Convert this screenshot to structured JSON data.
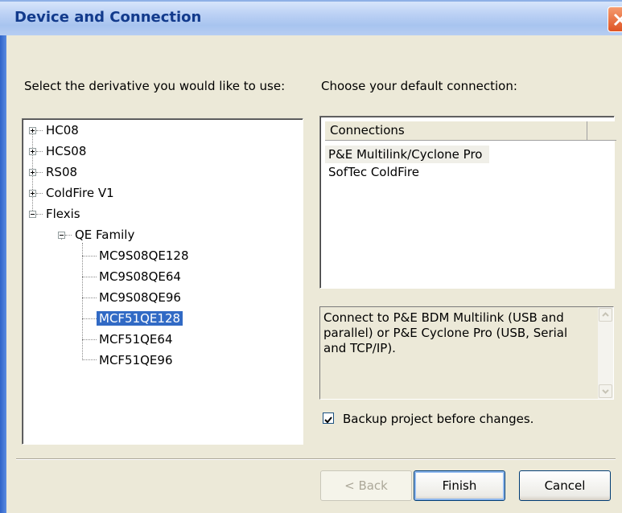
{
  "window": {
    "title": "Device and Connection"
  },
  "left": {
    "prompt": "Select the derivative you would like to use:",
    "tree": [
      {
        "label": "HC08",
        "expander": "+"
      },
      {
        "label": "HCS08",
        "expander": "+"
      },
      {
        "label": "RS08",
        "expander": "+"
      },
      {
        "label": "ColdFire V1",
        "expander": "+"
      },
      {
        "label": "Flexis",
        "expander": "−"
      },
      {
        "label": "QE Family",
        "expander": "−"
      },
      {
        "label": "MC9S08QE128"
      },
      {
        "label": "MC9S08QE64"
      },
      {
        "label": "MC9S08QE96"
      },
      {
        "label": "MCF51QE128",
        "selected": true
      },
      {
        "label": "MCF51QE64"
      },
      {
        "label": "MCF51QE96"
      }
    ]
  },
  "right": {
    "prompt": "Choose your default connection:",
    "column_header": "Connections",
    "connections": [
      {
        "label": "P&E Multilink/Cyclone Pro"
      },
      {
        "label": "SofTec ColdFire"
      }
    ],
    "description": "Connect to P&E BDM Multilink (USB and parallel) or P&E Cyclone Pro (USB, Serial and TCP/IP).",
    "backup_label": "Backup project before changes.",
    "backup_checked": true
  },
  "buttons": {
    "back": "< Back",
    "finish": "Finish",
    "cancel": "Cancel"
  }
}
